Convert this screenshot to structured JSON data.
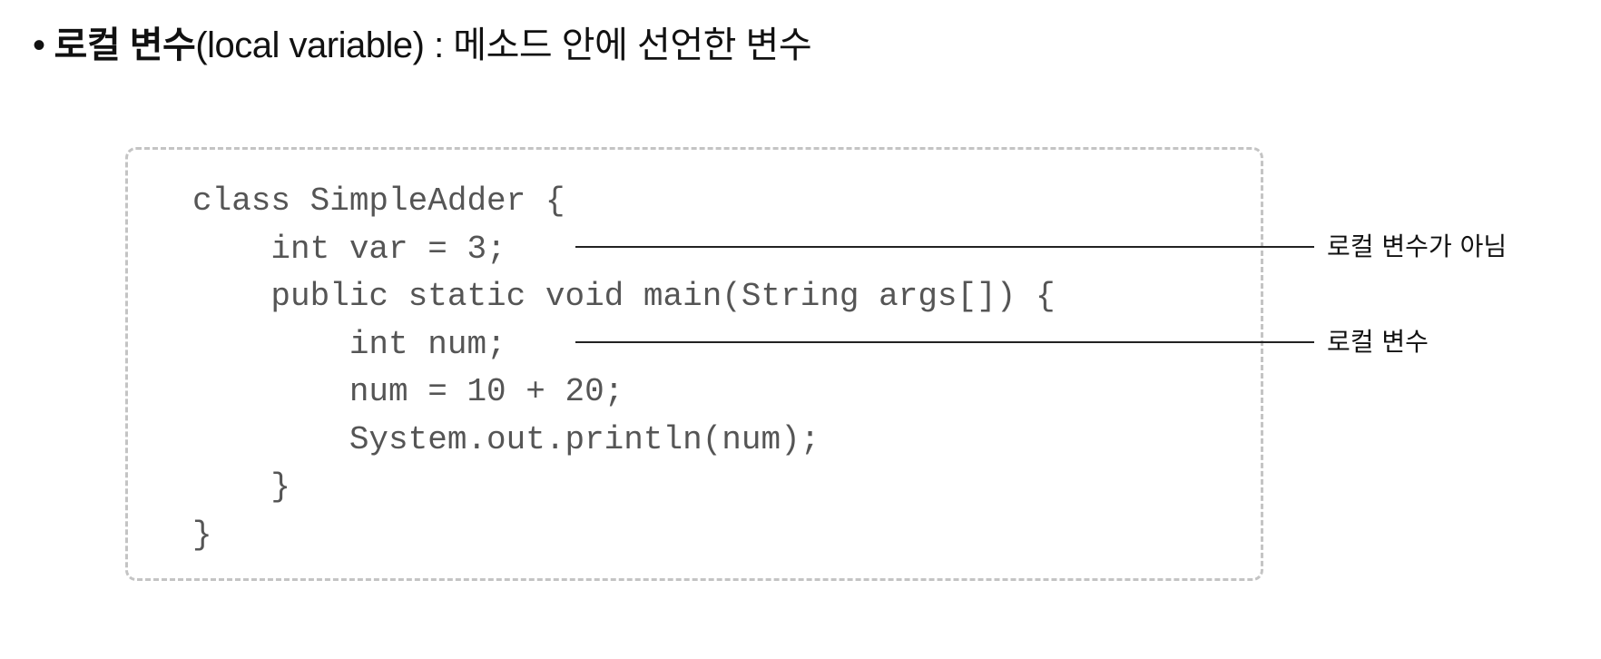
{
  "heading": {
    "bullet": "•",
    "term": "로컬 변수",
    "english": "(local variable)",
    "separator": " : ",
    "description": "메소드 안에 선언한 변수"
  },
  "code": {
    "lines": [
      "class SimpleAdder {",
      "    int var = 3;",
      "    public static void main(String args[]) {",
      "        int num;",
      "        num = 10 + 20;",
      "        System.out.println(num);",
      "    }",
      "}"
    ]
  },
  "annotations": [
    {
      "text": "로컬 변수가 아님",
      "target_line": 2
    },
    {
      "text": "로컬 변수",
      "target_line": 4
    }
  ]
}
